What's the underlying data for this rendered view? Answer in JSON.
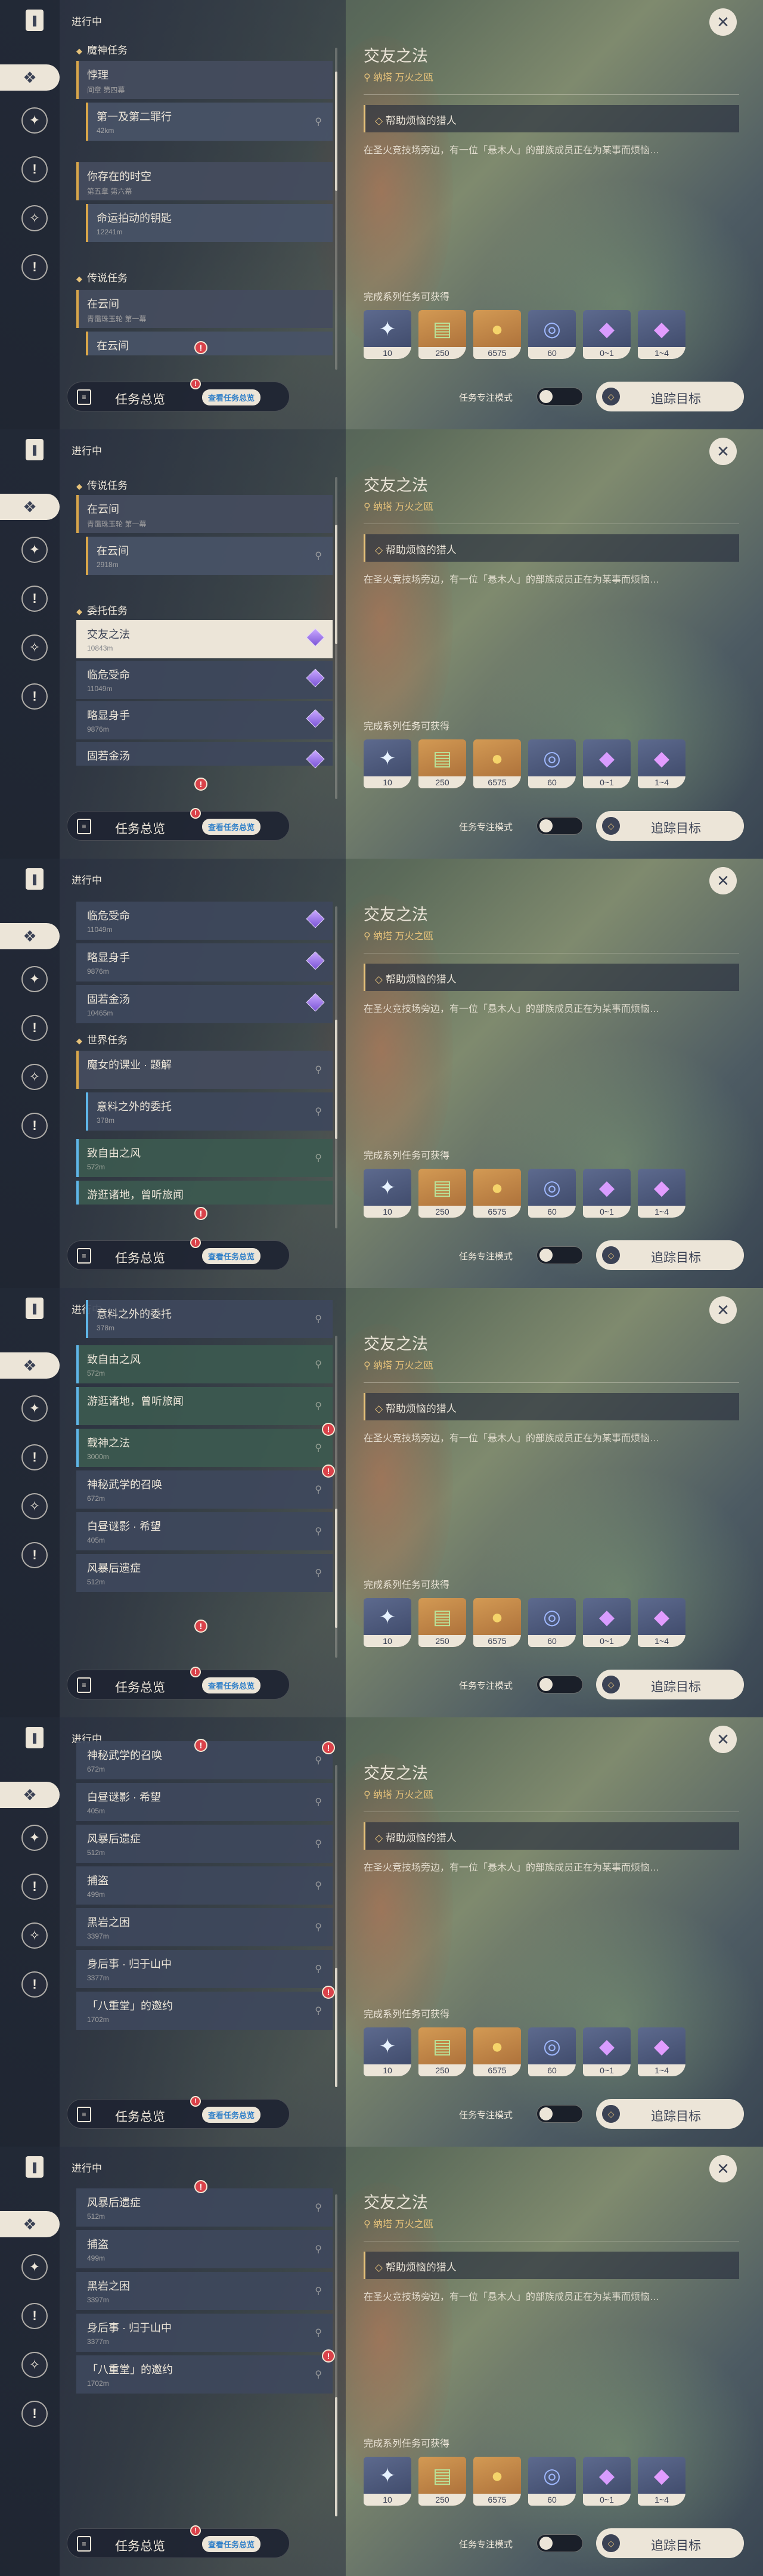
{
  "header": {
    "progress_label": "进行中",
    "close_glyph": "✕"
  },
  "rail": {
    "book_glyph": "❚",
    "active_glyph": "❖",
    "icon2_glyph": "✦",
    "icon3_glyph": "!",
    "icon4_glyph": "✧",
    "icon5_glyph": "!"
  },
  "groups": {
    "archon": "魔神任务",
    "legend": "传说任务",
    "commission": "委托任务",
    "world": "世界任务"
  },
  "quests": {
    "wuli": {
      "name": "悖理",
      "sub": "间章 第四幕"
    },
    "first_second": {
      "name": "第一及第二罪行",
      "sub": "42km"
    },
    "yourself": {
      "name": "你存在的时空",
      "sub": "第五章 第六幕"
    },
    "fate_key": {
      "name": "命运拍动的钥匙",
      "sub": "12241m"
    },
    "zaiyun": {
      "name": "在云间",
      "sub": "青霭珠玉轮 第一幕"
    },
    "zaiyun_child": {
      "name": "在云间",
      "sub": "2918m"
    },
    "jiaoyou": {
      "name": "交友之法",
      "sub": "10843m"
    },
    "linwei": {
      "name": "临危受命",
      "sub": "11049m"
    },
    "qiaoshen": {
      "name": "略显身手",
      "sub": "9876m"
    },
    "gujin": {
      "name": "固若金汤",
      "sub": "10465m"
    },
    "mohu": {
      "name": "魔女的课业 · 题解",
      "sub": ""
    },
    "yiliao": {
      "name": "意料之外的委托",
      "sub": "378m"
    },
    "ziyou": {
      "name": "致自由之风",
      "sub": "572m"
    },
    "youdang": {
      "name": "游逛诸地，曾听旅闻",
      "sub": ""
    },
    "zaishen": {
      "name": "载神之法",
      "sub": "3000m"
    },
    "shenmi": {
      "name": "神秘武学的召唤",
      "sub": "672m"
    },
    "baiye": {
      "name": "白昼谜影 · 希望",
      "sub": "405m"
    },
    "fengbao": {
      "name": "风暴后遗症",
      "sub": "512m"
    },
    "buzhuo": {
      "name": "捕盗",
      "sub": "499m"
    },
    "heiyan": {
      "name": "黑岩之困",
      "sub": "3397m"
    },
    "shenhou": {
      "name": "身后事 · 归于山中",
      "sub": "3377m"
    },
    "bachong": {
      "name": "「八重堂」的邀约",
      "sub": "1702m"
    }
  },
  "detail": {
    "title": "交友之法",
    "location": "纳塔  万火之瓯",
    "objective": "帮助烦恼的猎人",
    "description": "在圣火竞技场旁边，有一位「悬木人」的部族成员正在为某事而烦恼…",
    "rewards_label": "完成系列任务可获得",
    "rewards": [
      {
        "icon": "intertwined-fate-icon",
        "glyph": "✦",
        "qty": "10"
      },
      {
        "icon": "adventure-exp-icon",
        "glyph": "▤",
        "qty": "250"
      },
      {
        "icon": "mora-icon",
        "glyph": "●",
        "qty": "6575"
      },
      {
        "icon": "companionship-exp-icon",
        "glyph": "◎",
        "qty": "60"
      },
      {
        "icon": "crystal-fragment-icon",
        "glyph": "◆",
        "qty": "0~1"
      },
      {
        "icon": "crystal-chunk-icon",
        "glyph": "◆",
        "qty": "1~4"
      }
    ]
  },
  "footer": {
    "overview_label": "任务总览",
    "overview_tag": "查看任务总览",
    "focus_label": "任务专注模式",
    "track_label": "追踪目标",
    "notif_glyph": "!"
  },
  "colors": {
    "accent_gold": "#e6c27a",
    "panel_cream": "#ece5d8",
    "notif_red": "#d9424a",
    "commission_purple": "#7b55d6",
    "world_blue": "#5fb6e8"
  }
}
